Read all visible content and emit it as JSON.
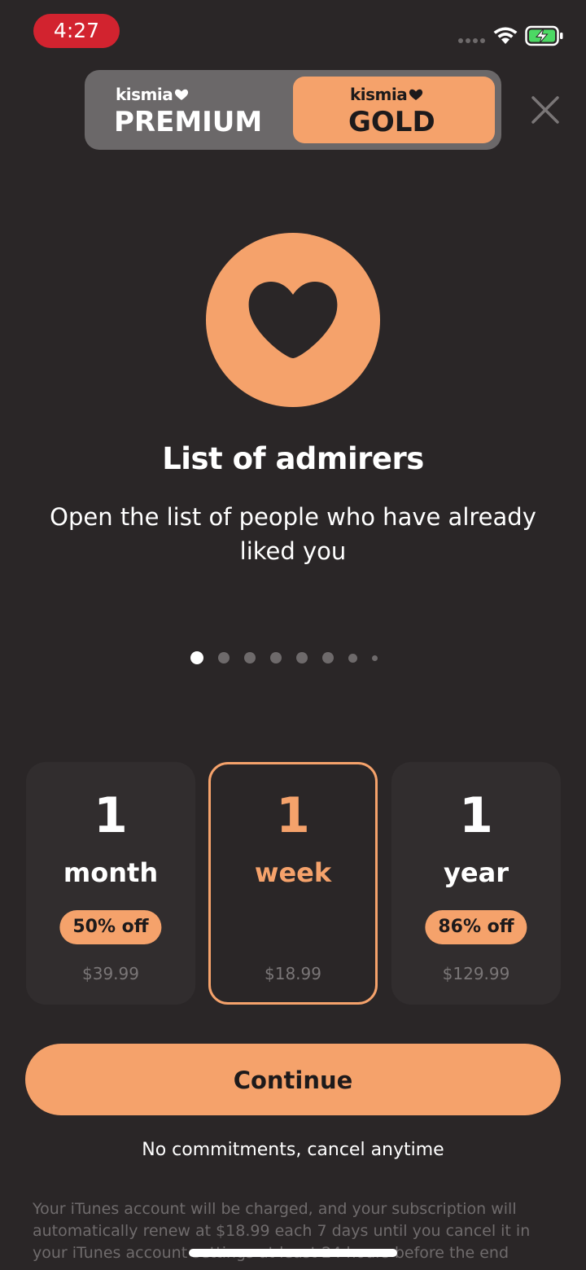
{
  "status_bar": {
    "time": "4:27"
  },
  "plan_toggle": {
    "premium": {
      "brand": "kismia",
      "tier": "PREMIUM"
    },
    "gold": {
      "brand": "kismia",
      "tier": "GOLD"
    },
    "selected": "gold"
  },
  "feature": {
    "icon": "heart-icon",
    "title": "List of admirers",
    "description": "Open the list of people who have already liked you"
  },
  "pager": {
    "total": 8,
    "active_index": 0
  },
  "plans": [
    {
      "count": "1",
      "unit": "month",
      "discount": "50% off",
      "price": "$39.99"
    },
    {
      "count": "1",
      "unit": "week",
      "discount": "",
      "price": "$18.99",
      "selected": true
    },
    {
      "count": "1",
      "unit": "year",
      "discount": "86% off",
      "price": "$129.99"
    }
  ],
  "continue_label": "Continue",
  "no_commitments": "No commitments, cancel anytime",
  "legal": {
    "line1": "Your iTunes account will be charged, and your subscription will",
    "line2": "automatically renew at $18.99 each 7 days until you cancel it in",
    "line3": "your iTunes account settings at least 24 hours before the end"
  },
  "colors": {
    "background": "#2a2627",
    "accent": "#f5a26b",
    "card": "#312d2e",
    "toggle_track": "#6b6869",
    "status_time_pill": "#d2232f"
  }
}
